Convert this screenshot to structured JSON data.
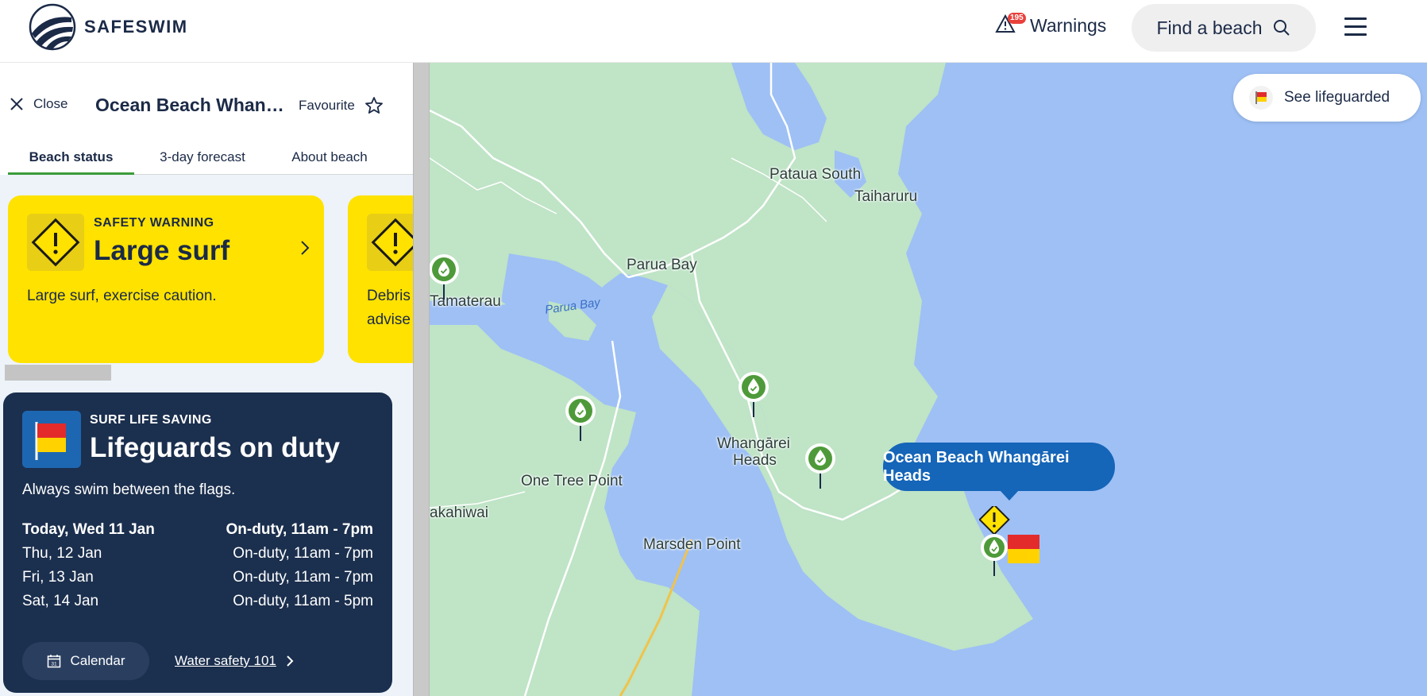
{
  "header": {
    "logo_text": "SAFESWIM",
    "warnings_label": "Warnings",
    "warnings_count": "195",
    "find_beach_label": "Find a beach"
  },
  "panel": {
    "close_label": "Close",
    "beach_title": "Ocean Beach Whangārei Heads",
    "favourite_label": "Favourite",
    "tabs": [
      {
        "label": "Beach status",
        "active": true
      },
      {
        "label": "3-day forecast",
        "active": false
      },
      {
        "label": "About beach",
        "active": false
      }
    ],
    "warning_cards": [
      {
        "kicker": "SAFETY WARNING",
        "headline": "Large surf",
        "description": "Large surf, exercise caution."
      },
      {
        "kicker": "",
        "headline": "",
        "description": "Debris advise"
      }
    ],
    "lifesaving": {
      "kicker": "SURF LIFE SAVING",
      "headline": "Lifeguards on duty",
      "subtext": "Always swim between the flags.",
      "schedule": [
        {
          "day": "Today, Wed 11 Jan",
          "status": "On-duty, 11am - 7pm"
        },
        {
          "day": "Thu, 12 Jan",
          "status": "On-duty, 11am - 7pm"
        },
        {
          "day": "Fri, 13 Jan",
          "status": "On-duty, 11am - 7pm"
        },
        {
          "day": "Sat, 14 Jan",
          "status": "On-duty, 11am - 5pm"
        }
      ],
      "calendar_label": "Calendar",
      "calendar_icon_text": "31",
      "water_safety_label": "Water safety 101"
    }
  },
  "map": {
    "see_lifeguarded_label": "See lifeguarded",
    "callout_label": "Ocean Beach Whangārei Heads",
    "places": [
      "Pataua South",
      "Taiharuru",
      "Parua Bay",
      "Tamaterau",
      "Whangārei",
      "Heads",
      "One Tree Point",
      "akahiwai",
      "Marsden Point"
    ],
    "water_label": "Parua Bay",
    "colors": {
      "water": "#9ec0f5",
      "land": "#bfe4c6",
      "pin": "#4e9a3a",
      "warning_yellow": "#ffe200",
      "callout": "#1565b8"
    }
  }
}
